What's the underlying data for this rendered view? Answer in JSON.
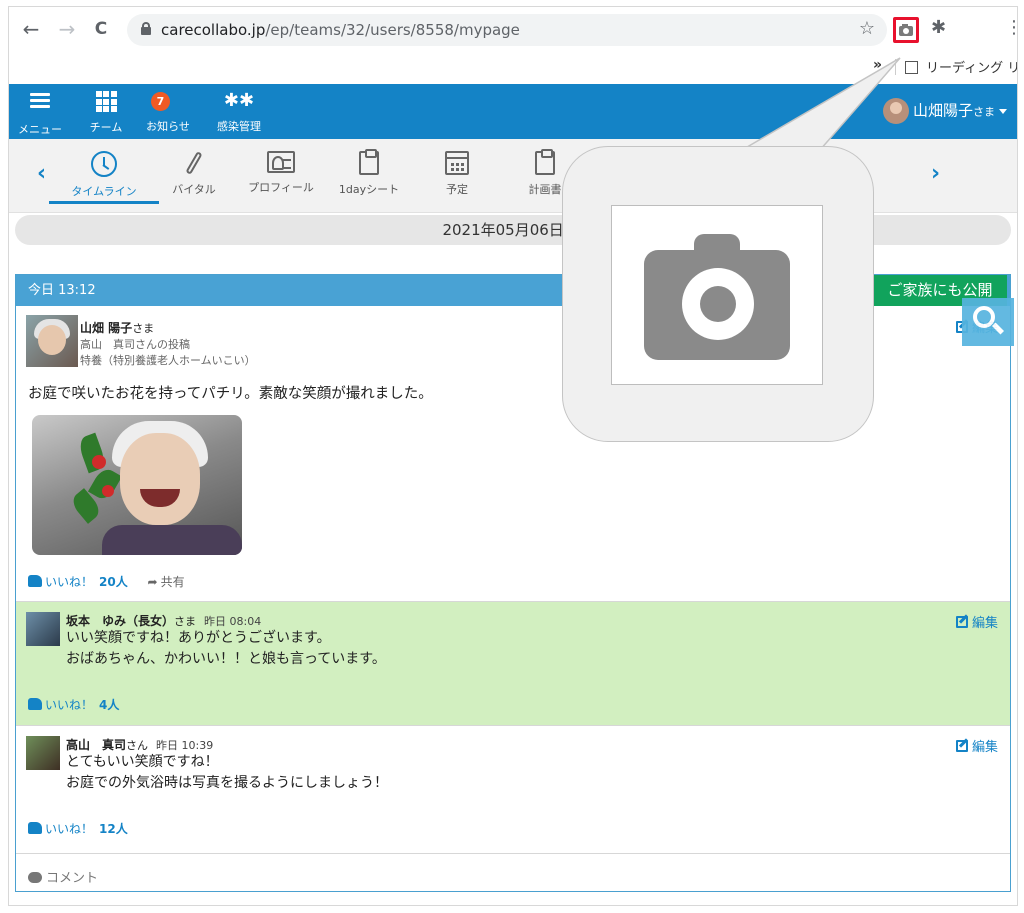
{
  "browser": {
    "url_host": "carecollabo.jp",
    "url_path": "/ep/teams/32/users/8558/mypage",
    "bookmarks_more": "»",
    "reading_list": "リーディング リスト",
    "back_glyph": "←",
    "forward_glyph": "→",
    "reload_glyph": "C",
    "star_glyph": "☆",
    "kebab_glyph": "⋮",
    "puzzle_glyph": "✱"
  },
  "appbar": {
    "menu_label": "メニュー",
    "team_label": "チーム",
    "notice_label": "お知らせ",
    "notice_badge": "7",
    "infection_label": "感染管理",
    "infection_glyph": "✱✱",
    "user_name": "山畑陽子",
    "user_suffix": "さま",
    "color": "#1483c6"
  },
  "tabs": {
    "prev_glyph": "‹",
    "next_glyph": "›",
    "items": [
      {
        "label": "タイムライン",
        "icon": "clock-icon",
        "active": true
      },
      {
        "label": "バイタル",
        "icon": "thermometer-icon"
      },
      {
        "label": "プロフィール",
        "icon": "id-card-icon"
      },
      {
        "label": "1dayシート",
        "icon": "clipboard-icon"
      },
      {
        "label": "予定",
        "icon": "calendar-icon"
      },
      {
        "label": "計画書",
        "icon": "clipboard-icon"
      }
    ]
  },
  "date_bar": "2021年05月06日 オ",
  "post": {
    "header_time": "今日 13:12",
    "family_button": "ご家族にも公開",
    "author_name": "山畑 陽子",
    "author_suffix": "さま",
    "posted_by": "高山　真司さんの投稿",
    "facility": "特養（特別養護老人ホームいこい）",
    "edit_label": "編集",
    "body": "お庭で咲いたお花を持ってパチリ。素敵な笑顔が撮れました。",
    "like_label": "いいね！",
    "like_count": "20人",
    "share_label": "共有",
    "share_glyph": "➦"
  },
  "comments": [
    {
      "name": "坂本　ゆみ（長女）",
      "suffix": "さま",
      "time": "昨日 08:04",
      "line1": "いい笑顔ですね！ありがとうございます。",
      "line2": "おばあちゃん、かわいい！！と娘も言っています。",
      "edit_label": "編集",
      "like_label": "いいね！",
      "like_count": "4人"
    },
    {
      "name": "高山　真司",
      "suffix": "さん",
      "time": "昨日 10:39",
      "line1": "とてもいい笑顔ですね！",
      "line2": "お庭での外気浴時は写真を撮るようにしましょう！",
      "edit_label": "編集",
      "like_label": "いいね！",
      "like_count": "12人"
    }
  ],
  "comment_input_label": "コメント",
  "colors": {
    "family_green": "#11a35c",
    "comment_green": "#d2efc0",
    "card_header": "#49a2d4",
    "highlight_red": "#e8112d"
  }
}
